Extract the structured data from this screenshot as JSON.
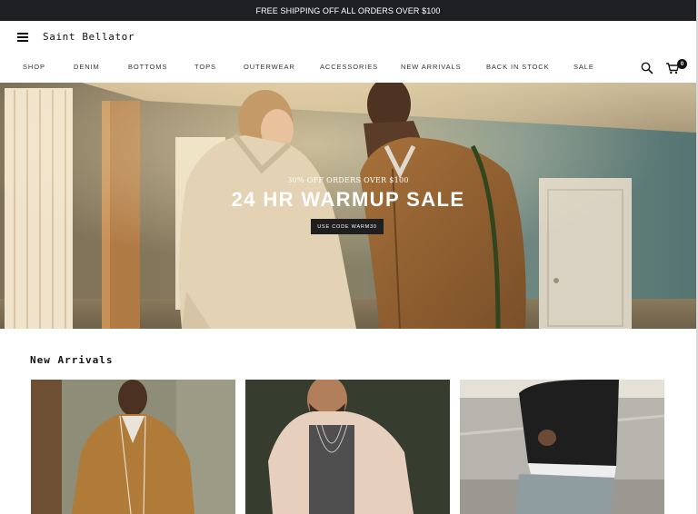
{
  "promo": {
    "text": "FREE SHIPPING OFF ALL ORDERS OVER $100"
  },
  "header": {
    "brand": "Saint Bellator",
    "cart_count": "0",
    "nav": [
      "SHOP",
      "DENIM",
      "BOTTOMS",
      "TOPS",
      "OUTERWEAR",
      "ACCESSORIES",
      "NEW ARRIVALS",
      "BACK IN STOCK",
      "SALE"
    ],
    "icons": {
      "menu": "hamburger-icon",
      "search": "search-icon",
      "cart": "cart-icon"
    }
  },
  "hero": {
    "subtitle": "30% OFF ORDERS OVER $100",
    "title": "24 HR WARMUP SALE",
    "cta": "USE CODE WARM30"
  },
  "new_arrivals": {
    "title": "New Arrivals",
    "products": [
      {
        "image": "model in tan suede track jacket"
      },
      {
        "image": "model in cream sherpa jacket with necklaces"
      },
      {
        "image": "model in black hoodie and light jeans on street"
      }
    ]
  },
  "colors": {
    "promo_bg": "#1f2023",
    "cta_bg": "#1f1f1f",
    "text": "#111111"
  }
}
